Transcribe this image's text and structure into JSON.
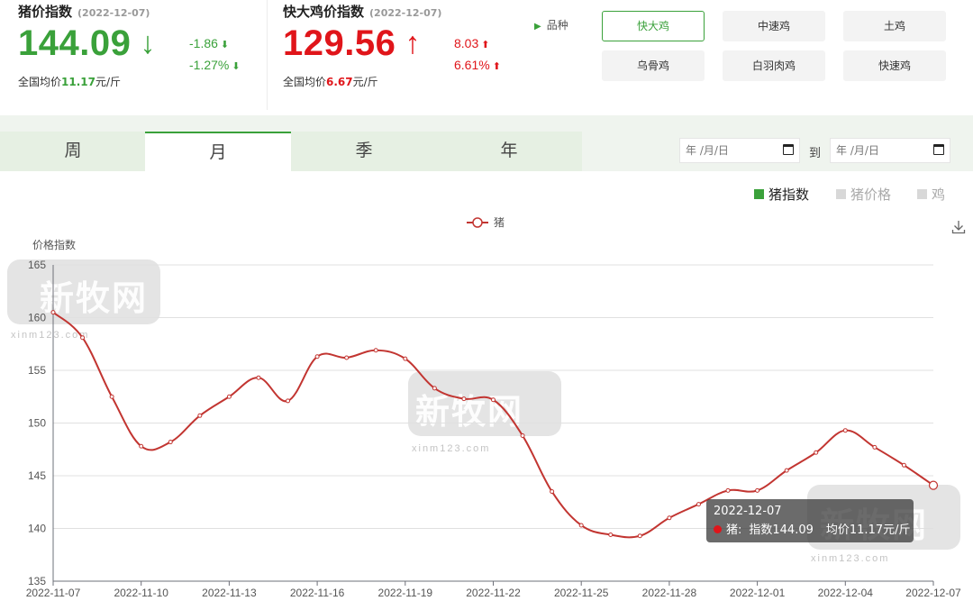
{
  "pig_card": {
    "title": "猪价指数",
    "date": "(2022-12-07)",
    "value": "144.09",
    "direction": "down",
    "change_abs": "-1.86",
    "change_pct": "-1.27%",
    "avg_prefix": "全国均价",
    "avg_value": "11.17",
    "avg_unit": "元/斤",
    "color": "#3aa13a"
  },
  "chicken_card": {
    "title": "快大鸡价指数",
    "date": "(2022-12-07)",
    "value": "129.56",
    "direction": "up",
    "change_abs": "8.03",
    "change_pct": "6.61%",
    "avg_prefix": "全国均价",
    "avg_value": "6.67",
    "avg_unit": "元/斤",
    "color": "#e0151a"
  },
  "variety": {
    "label": "品种",
    "options": [
      "快大鸡",
      "中速鸡",
      "土鸡",
      "乌骨鸡",
      "白羽肉鸡",
      "快速鸡"
    ],
    "selected": "快大鸡"
  },
  "tabs": {
    "items": [
      "周",
      "月",
      "季",
      "年"
    ],
    "active": "月"
  },
  "date_range": {
    "start_placeholder": "年 /月/日",
    "to_label": "到",
    "end_placeholder": "年 /月/日"
  },
  "series_toggles": [
    {
      "label": "猪指数",
      "on": true
    },
    {
      "label": "猪价格",
      "on": false
    },
    {
      "label": "鸡",
      "on": false
    }
  ],
  "icons": {
    "download": "download-icon",
    "calendar": "calendar-icon",
    "arrow_down": "arrow-down-icon",
    "arrow_up": "arrow-up-icon",
    "play": "triangle-right-icon"
  },
  "watermark": {
    "text": "新牧网",
    "url": "xinm123.com"
  },
  "tooltip": {
    "date": "2022-12-07",
    "series": "猪:",
    "index_label": "指数144.09",
    "price_label": "均价11.17元/斤"
  },
  "chart_data": {
    "type": "line",
    "title": "",
    "ylabel": "价格指数",
    "xlabel": "",
    "ylim": [
      135,
      165
    ],
    "yticks": [
      135,
      140,
      145,
      150,
      155,
      160,
      165
    ],
    "grid": true,
    "legend_position": "top-center",
    "x": [
      "2022-11-07",
      "2022-11-08",
      "2022-11-09",
      "2022-11-10",
      "2022-11-11",
      "2022-11-12",
      "2022-11-13",
      "2022-11-14",
      "2022-11-15",
      "2022-11-16",
      "2022-11-17",
      "2022-11-18",
      "2022-11-19",
      "2022-11-20",
      "2022-11-21",
      "2022-11-22",
      "2022-11-23",
      "2022-11-24",
      "2022-11-25",
      "2022-11-26",
      "2022-11-27",
      "2022-11-28",
      "2022-11-29",
      "2022-11-30",
      "2022-12-01",
      "2022-12-02",
      "2022-12-03",
      "2022-12-04",
      "2022-12-05",
      "2022-12-06",
      "2022-12-07"
    ],
    "xtick_labels": [
      "2022-11-07",
      "2022-11-10",
      "2022-11-13",
      "2022-11-16",
      "2022-11-19",
      "2022-11-22",
      "2022-11-25",
      "2022-11-28",
      "2022-12-01",
      "2022-12-04",
      "2022-12-07"
    ],
    "series": [
      {
        "name": "猪",
        "color": "#c23531",
        "values": [
          160.5,
          158.1,
          152.5,
          147.8,
          148.2,
          150.7,
          152.5,
          154.3,
          152.1,
          156.3,
          156.2,
          156.9,
          156.1,
          153.3,
          152.3,
          152.2,
          148.8,
          143.5,
          140.3,
          139.4,
          139.3,
          141.0,
          142.3,
          143.6,
          143.6,
          145.5,
          147.2,
          149.3,
          147.7,
          146.0,
          144.09
        ]
      }
    ],
    "highlighted_index": 30
  }
}
